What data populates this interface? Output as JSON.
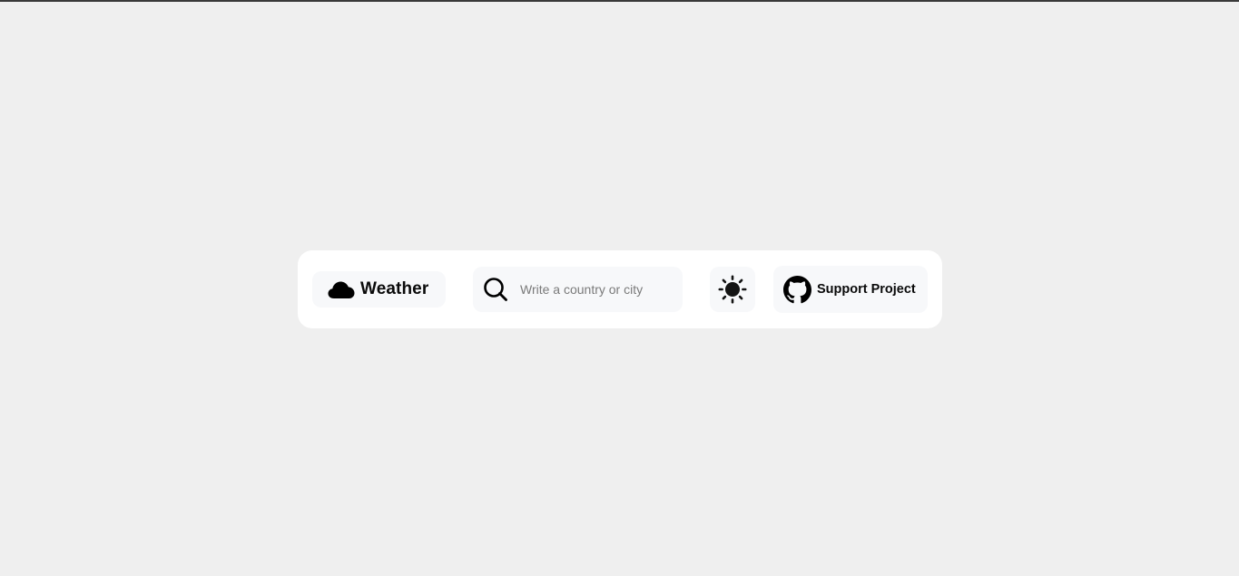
{
  "brand": {
    "icon": "cloud-icon",
    "label": "Weather"
  },
  "search": {
    "icon": "search-icon",
    "placeholder": "Write a country or city",
    "value": ""
  },
  "theme_toggle": {
    "icon": "sun-icon"
  },
  "support": {
    "icon": "github-icon",
    "label": "Support Project"
  },
  "colors": {
    "page_background": "#efefef",
    "toolbar_background": "#ffffff",
    "control_background": "#f7f8fa",
    "text": "#0a0a0a",
    "placeholder": "#7a7a7a"
  }
}
